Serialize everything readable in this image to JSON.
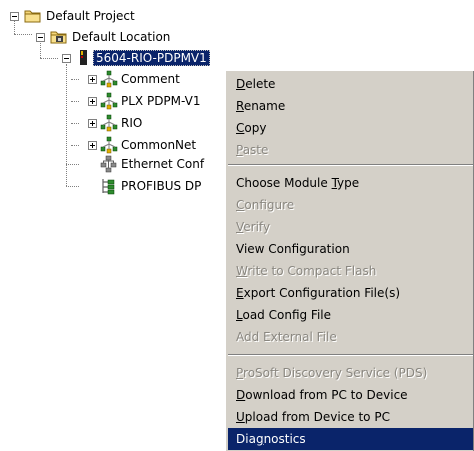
{
  "tree": {
    "project": {
      "label": "Default Project",
      "icon": "folder-icon"
    },
    "location": {
      "label": "Default Location",
      "icon": "location-folder-icon"
    },
    "module": {
      "label": "5604-RIO-PDPMV1",
      "icon": "module-icon"
    },
    "children": [
      {
        "label": "Comment",
        "icon": "network-node-icon"
      },
      {
        "label": "PLX PDPM-V1",
        "icon": "network-node-icon"
      },
      {
        "label": "RIO",
        "icon": "network-node-icon"
      },
      {
        "label": "CommonNet",
        "icon": "network-node-icon"
      },
      {
        "label": "Ethernet Conf",
        "icon": "ethernet-config-icon"
      },
      {
        "label": "PROFIBUS DP",
        "icon": "profibus-icon"
      }
    ]
  },
  "menu": {
    "items": [
      {
        "pre": "",
        "key": "D",
        "post": "elete",
        "disabled": false
      },
      {
        "pre": "",
        "key": "R",
        "post": "ename",
        "disabled": false
      },
      {
        "pre": "",
        "key": "C",
        "post": "opy",
        "disabled": false
      },
      {
        "pre": "",
        "key": "P",
        "post": "aste",
        "disabled": true
      },
      {
        "pre": "Choose Module ",
        "key": "T",
        "post": "ype",
        "disabled": false
      },
      {
        "pre": "",
        "key": "C",
        "post": "onfigure",
        "disabled": true
      },
      {
        "pre": "",
        "key": "V",
        "post": "erify",
        "disabled": true
      },
      {
        "pre": "View Configuration",
        "key": "",
        "post": "",
        "disabled": false
      },
      {
        "pre": "",
        "key": "W",
        "post": "rite to Compact Flash",
        "disabled": true
      },
      {
        "pre": "",
        "key": "E",
        "post": "xport Configuration File(s)",
        "disabled": false
      },
      {
        "pre": "",
        "key": "L",
        "post": "oad Config File",
        "disabled": false
      },
      {
        "pre": "Add External File",
        "key": "",
        "post": "",
        "disabled": true
      },
      {
        "pre": "",
        "key": "P",
        "post": "roSoft Discovery Service (PDS)",
        "disabled": true
      },
      {
        "pre": "",
        "key": "D",
        "post": "ownload from PC to Device",
        "disabled": false
      },
      {
        "pre": "",
        "key": "U",
        "post": "pload from Device to PC",
        "disabled": false
      },
      {
        "pre": "Dia",
        "key": "g",
        "post": "nostics",
        "disabled": false,
        "highlighted": true
      }
    ]
  },
  "colors": {
    "menu_bg": "#d4d0c8",
    "highlight": "#0a246a",
    "disabled_text": "#8a8780"
  }
}
